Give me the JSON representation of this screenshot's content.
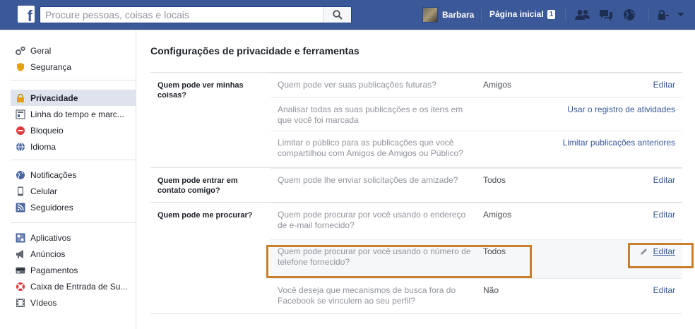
{
  "topbar": {
    "logo": "f",
    "search_placeholder": "Procure pessoas, coisas e locais",
    "user_name": "Barbara",
    "home_label": "Página inicial",
    "home_badge": "1",
    "brand_color": "#3b5998"
  },
  "sidebar": {
    "groups": [
      {
        "items": [
          {
            "label": "Geral",
            "icon": "gears-icon"
          },
          {
            "label": "Segurança",
            "icon": "shield-icon"
          }
        ]
      },
      {
        "items": [
          {
            "label": "Privacidade",
            "icon": "lock-icon",
            "active": true
          },
          {
            "label": "Linha do tempo e marc...",
            "icon": "timeline-icon"
          },
          {
            "label": "Bloqueio",
            "icon": "block-icon"
          },
          {
            "label": "Idioma",
            "icon": "globe-icon"
          }
        ]
      },
      {
        "items": [
          {
            "label": "Notificações",
            "icon": "globe-notification-icon"
          },
          {
            "label": "Celular",
            "icon": "phone-icon"
          },
          {
            "label": "Seguidores",
            "icon": "rss-icon"
          }
        ]
      },
      {
        "items": [
          {
            "label": "Aplicativos",
            "icon": "apps-icon"
          },
          {
            "label": "Anúncios",
            "icon": "megaphone-icon"
          },
          {
            "label": "Pagamentos",
            "icon": "card-icon"
          },
          {
            "label": "Caixa de Entrada de Su...",
            "icon": "lifebuoy-icon"
          },
          {
            "label": "Vídeos",
            "icon": "film-icon"
          }
        ]
      }
    ]
  },
  "main": {
    "title": "Configurações de privacidade e ferramentas",
    "sections": [
      {
        "label": "Quem pode ver minhas coisas?",
        "rows": [
          {
            "question": "Quem pode ver suas publicações futuras?",
            "value": "Amigos",
            "action": "Editar"
          },
          {
            "question": "Analisar todas as suas publicações e os itens em que você foi marcada",
            "value": "",
            "action": "Usar o registro de atividades"
          },
          {
            "question": "Limitar o público para as publicações que você compartilhou com Amigos de Amigos ou Público?",
            "value": "",
            "action": "Limitar publicações anteriores"
          }
        ]
      },
      {
        "label": "Quem pode entrar em contato comigo?",
        "rows": [
          {
            "question": "Quem pode lhe enviar solicitações de amizade?",
            "value": "Todos",
            "action": "Editar"
          }
        ]
      },
      {
        "label": "Quem pode me procurar?",
        "rows": [
          {
            "question": "Quem pode procurar por você usando o endereço de e-mail fornecido?",
            "value": "Amigos",
            "action": "Editar"
          },
          {
            "question": "Quem pode procurar por você usando o número de telefone fornecido?",
            "value": "Todos",
            "action": "Editar",
            "highlighted": true
          },
          {
            "question": "Você deseja que mecanismos de busca fora do Facebook se vinculem ao seu perfil?",
            "value": "Não",
            "action": "Editar"
          }
        ]
      }
    ]
  },
  "highlight_color": "#c87e2a"
}
